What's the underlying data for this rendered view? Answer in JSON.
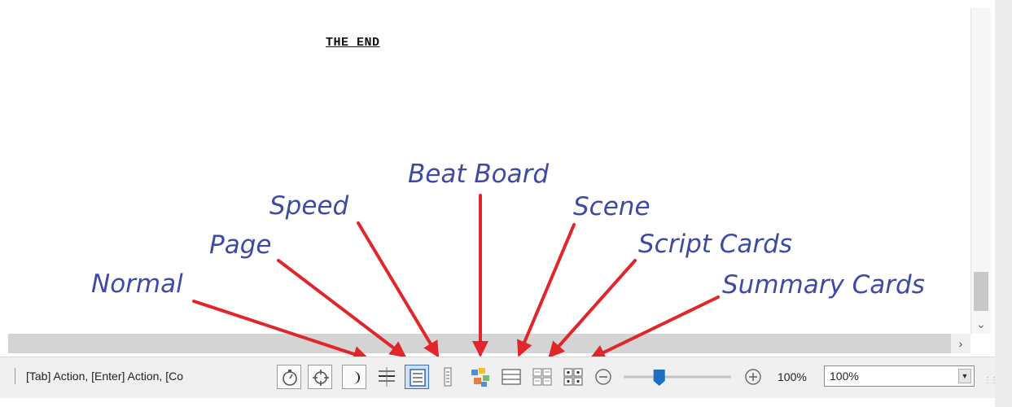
{
  "document": {
    "last_line": "THE END"
  },
  "annotations": [
    {
      "label": "Normal"
    },
    {
      "label": "Page"
    },
    {
      "label": "Speed"
    },
    {
      "label": "Beat Board"
    },
    {
      "label": "Scene"
    },
    {
      "label": "Script Cards"
    },
    {
      "label": "Summary Cards"
    }
  ],
  "statusbar": {
    "text": "[Tab]  Action,  [Enter] Action, [Co",
    "toolbar": [
      {
        "icon": "stopwatch-icon",
        "tooltip": "Stopwatch"
      },
      {
        "icon": "target-icon",
        "tooltip": "Navigator"
      },
      {
        "icon": "moon-icon",
        "tooltip": "Night mode"
      },
      {
        "icon": "normal-view-icon",
        "tooltip": "Normal",
        "active": false
      },
      {
        "icon": "page-view-icon",
        "tooltip": "Page",
        "active": true
      },
      {
        "icon": "speed-view-icon",
        "tooltip": "Speed",
        "active": false
      },
      {
        "icon": "beat-board-icon",
        "tooltip": "Beat Board",
        "active": false
      },
      {
        "icon": "scene-view-icon",
        "tooltip": "Scene",
        "active": false
      },
      {
        "icon": "script-cards-icon",
        "tooltip": "Script Cards",
        "active": false
      },
      {
        "icon": "summary-cards-icon",
        "tooltip": "Summary Cards",
        "active": false
      }
    ],
    "zoom_level": 1.0,
    "zoom_text": "100%",
    "zoom_select_value": "100%"
  },
  "colors": {
    "annotation": "#3d4aa6",
    "arrow": "#e0262a",
    "active_button": "#cfe0f5",
    "slider_thumb": "#1e6fc4"
  }
}
